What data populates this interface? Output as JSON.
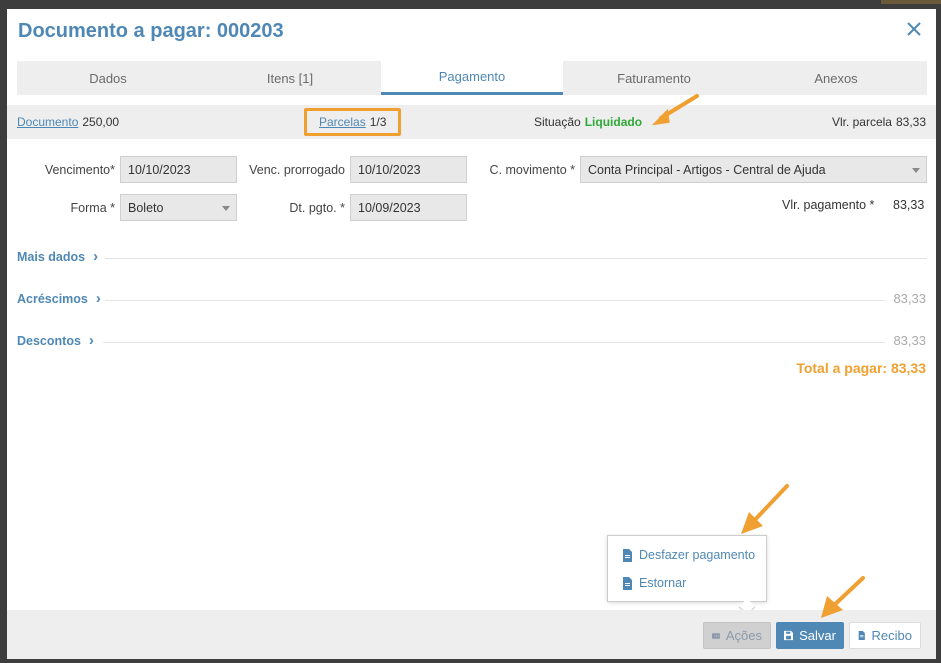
{
  "modal": {
    "title": "Documento a pagar: 000203"
  },
  "tabs": [
    {
      "label": "Dados",
      "active": false
    },
    {
      "label": "Itens [1]",
      "active": false
    },
    {
      "label": "Pagamento",
      "active": true
    },
    {
      "label": "Faturamento",
      "active": false
    },
    {
      "label": "Anexos",
      "active": false
    }
  ],
  "summary": {
    "documento_label": "Documento",
    "documento_value": "250,00",
    "parcelas_label": "Parcelas",
    "parcelas_value": "1/3",
    "situacao_label": "Situação",
    "situacao_value": "Liquidado",
    "vlr_parcela_label": "Vlr. parcela",
    "vlr_parcela_value": "83,33"
  },
  "form": {
    "vencimento_label": "Vencimento*",
    "vencimento_value": "10/10/2023",
    "venc_prorrogado_label": "Venc. prorrogado",
    "venc_prorrogado_value": "10/10/2023",
    "c_movimento_label": "C. movimento *",
    "c_movimento_value": "Conta Principal - Artigos - Central de Ajuda",
    "forma_label": "Forma *",
    "forma_value": "Boleto",
    "dt_pgto_label": "Dt. pgto. *",
    "dt_pgto_value": "10/09/2023",
    "vlr_pagamento_label": "Vlr. pagamento *",
    "vlr_pagamento_value": "83,33"
  },
  "sections": {
    "mais_dados": "Mais dados",
    "acrescimos": "Acréscimos",
    "acrescimos_value": "83,33",
    "descontos": "Descontos",
    "descontos_value": "83,33",
    "total_label": "Total a pagar: 83,33"
  },
  "popup": {
    "desfazer": "Desfazer pagamento",
    "estornar": "Estornar"
  },
  "footer": {
    "acoes": "Ações",
    "salvar": "Salvar",
    "recibo": "Recibo"
  },
  "colors": {
    "primary": "#4f88b5",
    "accent_orange": "#f0a030",
    "status_green": "#2fa836"
  }
}
